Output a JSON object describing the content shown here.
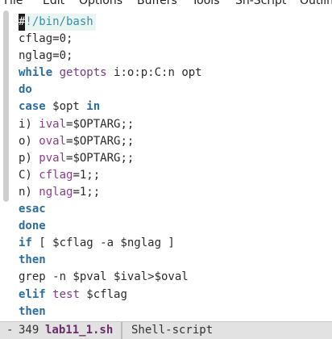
{
  "menubar": {
    "items": [
      "File",
      "Edit",
      "Options",
      "Buffers",
      "Tools",
      "Sh-Script",
      "Outlin"
    ]
  },
  "editor": {
    "lines": [
      {
        "text": "#!/bin/bash"
      },
      {
        "text": "cflag=0;"
      },
      {
        "text": "nglag=0;"
      },
      {
        "text": "while getopts i:o:p:C:n opt"
      },
      {
        "text": "do"
      },
      {
        "text": "case $opt in"
      },
      {
        "text": "i) ival=$OPTARG;;"
      },
      {
        "text": "o) oval=$OPTARG;;"
      },
      {
        "text": "p) pval=$OPTARG;;"
      },
      {
        "text": "C) cflag=1;;"
      },
      {
        "text": "n) nglag=1;;"
      },
      {
        "text": "esac"
      },
      {
        "text": "done"
      },
      {
        "text": "if [ $cflag -a $nglag ]"
      },
      {
        "text": "then"
      },
      {
        "text": "grep -n $pval $ival>$oval"
      },
      {
        "text": "elif test $cflag"
      },
      {
        "text": "then"
      }
    ]
  },
  "modeline": {
    "status": "-",
    "line_number": "349",
    "buffer_name": "lab11_1.sh",
    "major_mode": "Shell-script"
  }
}
